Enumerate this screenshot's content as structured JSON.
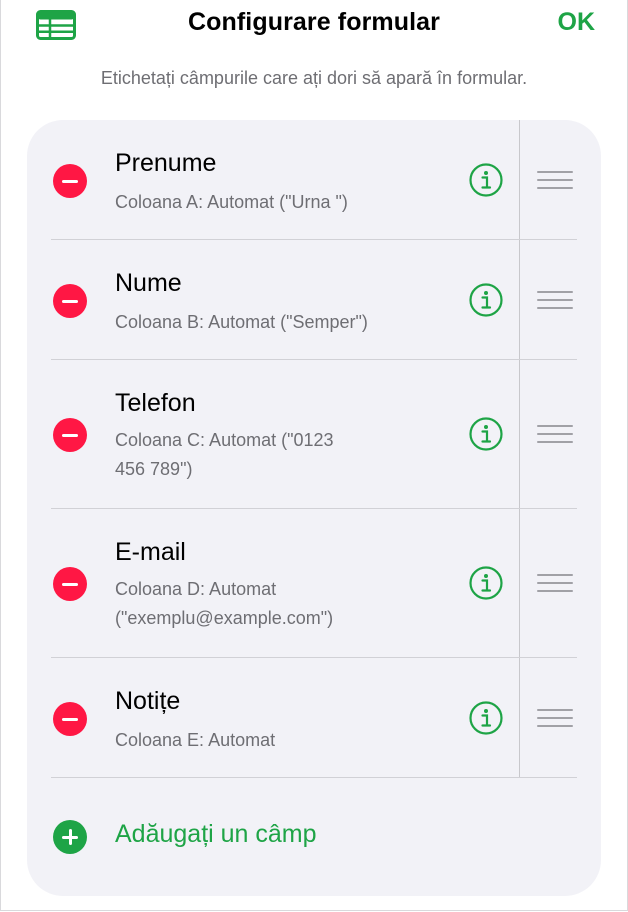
{
  "header": {
    "title": "Configurare formular",
    "done_label": "OK",
    "left_icon": "table-icon",
    "accent_color": "#1ea446"
  },
  "subtitle": "Etichetați câmpurile care ați dori să apară în formular.",
  "fields": [
    {
      "name": "Prenume",
      "detail": "Coloana A: Automat (\"Urna \")"
    },
    {
      "name": "Nume",
      "detail": "Coloana B: Automat (\"Semper\")"
    },
    {
      "name": "Telefon",
      "detail_lines": [
        "Coloana C: Automat (\"0123",
        "456 789\")"
      ]
    },
    {
      "name": "E-mail",
      "detail_lines": [
        "Coloana D: Automat",
        "(\"exemplu@example.com\")"
      ]
    },
    {
      "name": "Notițe",
      "detail": "Coloana E: Automat"
    }
  ],
  "add_field_label": "Adăugați un câmp",
  "delete_color": "#ff1744"
}
